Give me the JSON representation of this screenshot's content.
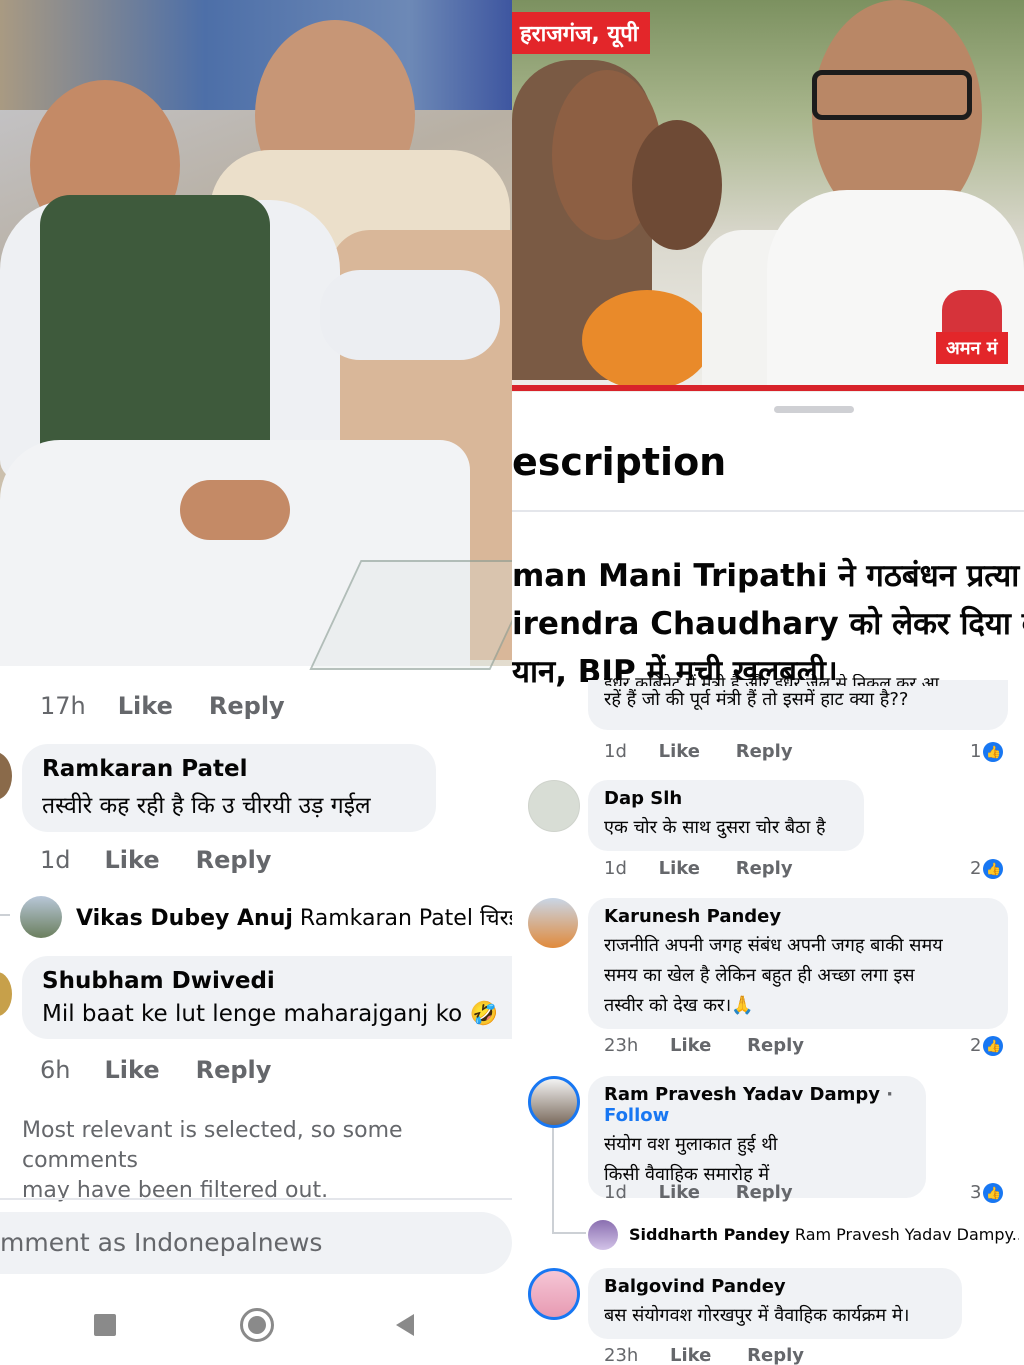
{
  "left": {
    "photo_alt": "",
    "top_meta": {
      "time": "17h",
      "like": "Like",
      "reply": "Reply"
    },
    "comments": [
      {
        "name": "Ramkaran Patel",
        "text": "तस्वीरे कह रही है कि उ चीरयी उड़ गईल",
        "time": "1d",
        "like": "Like",
        "reply": "Reply"
      },
      {
        "name": "Shubham Dwivedi",
        "text": "Mil baat ke lut lenge maharajganj ko",
        "emoji": "🤣",
        "time": "6h",
        "like": "Like",
        "reply": "Reply"
      }
    ],
    "nested_reply": {
      "name": "Vikas Dubey Anuj",
      "text": "Ramkaran Patel चिरई वाप"
    },
    "filter_hint": "Most relevant is selected, so some comments may have been filtered out.",
    "filter_hint_line1": "Most relevant is selected, so some comments",
    "filter_hint_line2": "may have been filtered out.",
    "input_placeholder": "mment as Indonepalnews"
  },
  "right": {
    "location_tag": "हराजगंज, यूपी",
    "reporter_tag": "अमन मं",
    "description_title": "escription",
    "description_line1": "man Mani Tripathi ने गठबंधन प्रत्या",
    "description_line2": "irendra Chaudhary को लेकर दिया ब",
    "description_line3": "यान, BJP में मची खलबली।",
    "partial_comment": {
      "line1": "इधर कबिनेट में मंत्री है और इधर जेल से निकल कर आ",
      "line2": "रहें हैं जो की पूर्व मंत्री हैं तो इसमें हाट क्या है??",
      "time": "1d",
      "like": "Like",
      "reply": "Reply",
      "reactions": "1"
    },
    "comments": [
      {
        "name": "Dap Slh",
        "lines": [
          "एक चोर के साथ दुसरा चोर बैठा है"
        ],
        "time": "1d",
        "like": "Like",
        "reply": "Reply",
        "reactions": "2"
      },
      {
        "name": "Karunesh Pandey",
        "lines": [
          "राजनीति अपनी जगह संबंध अपनी जगह बाकी समय",
          "समय का खेल है लेकिन बहुत ही अच्छा लगा इस",
          "तस्वीर को देख कर।🙏"
        ],
        "time": "23h",
        "like": "Like",
        "reply": "Reply",
        "reactions": "2"
      },
      {
        "name": "Ram Pravesh Yadav Dampy",
        "follow": "Follow",
        "lines": [
          "संयोग वश मुलाकात हुई थी",
          "किसी वैवाहिक समारोह में"
        ],
        "time": "1d",
        "like": "Like",
        "reply": "Reply",
        "reactions": "3"
      },
      {
        "name": "Balgovind Pandey",
        "lines": [
          "बस संयोगवश गोरखपुर में वैवाहिक कार्यक्रम मे।"
        ],
        "time": "23h",
        "like": "Like",
        "reply": "Reply"
      }
    ],
    "nested_reply": {
      "name": "Siddharth Pandey",
      "text": "Ram Pravesh Yadav Dampy..."
    }
  },
  "icons": [
    "square-nav-icon",
    "home-circle-nav-icon",
    "back-triangle-nav-icon",
    "like-thumb-icon"
  ],
  "colors": {
    "accent": "#1877f2",
    "bubble": "#f0f2f5",
    "meta": "#65676b",
    "tag_red": "#e3262a"
  }
}
